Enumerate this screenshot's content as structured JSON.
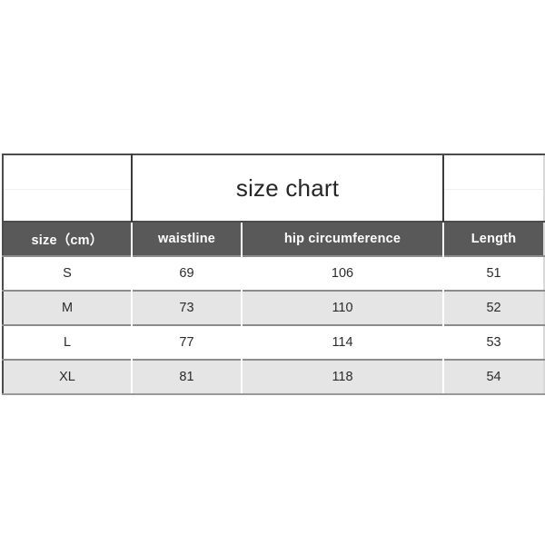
{
  "background_color": "#ffffff",
  "table": {
    "title": "size chart",
    "header_bg_color": "#595959",
    "header_text_color": "#ffffff",
    "row_alt_color": "#e5e5e5",
    "columns": [
      {
        "key": "size",
        "label": "size（cm）"
      },
      {
        "key": "waist",
        "label": "waistline"
      },
      {
        "key": "hip",
        "label": "hip circumference"
      },
      {
        "key": "length",
        "label": "Length"
      }
    ],
    "rows": [
      {
        "size": "S",
        "waist": "69",
        "hip": "106",
        "length": "51"
      },
      {
        "size": "M",
        "waist": "73",
        "hip": "110",
        "length": "52"
      },
      {
        "size": "L",
        "waist": "77",
        "hip": "114",
        "length": "53"
      },
      {
        "size": "XL",
        "waist": "81",
        "hip": "118",
        "length": "54"
      }
    ]
  },
  "chart_data": {
    "type": "table",
    "title": "size chart",
    "categories": [
      "S",
      "M",
      "L",
      "XL"
    ],
    "columns": [
      "size（cm）",
      "waistline",
      "hip circumference",
      "Length"
    ],
    "series": [
      {
        "name": "waistline",
        "values": [
          69,
          73,
          77,
          81
        ]
      },
      {
        "name": "hip circumference",
        "values": [
          106,
          110,
          114,
          118
        ]
      },
      {
        "name": "Length",
        "values": [
          51,
          52,
          53,
          54
        ]
      }
    ],
    "unit": "cm",
    "xlabel": "size（cm）",
    "ylabel": "",
    "grid": true,
    "legend": "none"
  }
}
